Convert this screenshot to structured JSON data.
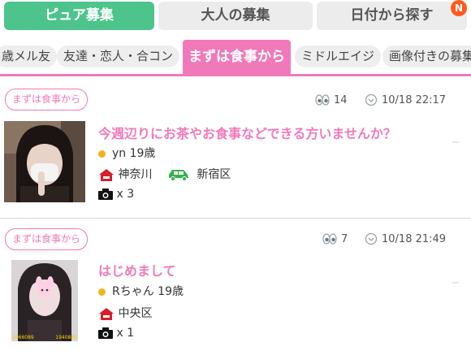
{
  "tabs": [
    {
      "label": "ピュア募集",
      "active": true
    },
    {
      "label": "大人の募集",
      "active": false
    },
    {
      "label": "日付から探す",
      "active": false
    }
  ],
  "notification_badge": "N",
  "categories": [
    {
      "label": "歳メル友",
      "active": false
    },
    {
      "label": "友達・恋人・合コン",
      "active": false
    },
    {
      "label": "まずは食事から",
      "active": true
    },
    {
      "label": "ミドルエイジ",
      "active": false
    },
    {
      "label": "画像付きの募集",
      "active": false
    }
  ],
  "posts": [
    {
      "tag": "まずは食事から",
      "views": "14",
      "datetime": "10/18 22:17",
      "title": "今週辺りにお茶やお食事などできる方いませんか？",
      "user": "yn 19歳",
      "home": "神奈川",
      "destination": "新宿区",
      "photos": "x 3"
    },
    {
      "tag": "まずは食事から",
      "views": "7",
      "datetime": "10/18 21:49",
      "title": "はじめまして",
      "user": "Rちゃん 19歳",
      "home": "中央区",
      "photos": "x 1",
      "thumb_caption_left": "2066089",
      "thumb_caption_right": "1940849"
    }
  ],
  "colors": {
    "accent_pink": "#f07ab9",
    "tab_green": "#4cc48b",
    "badge_orange": "#ff5a1f",
    "house_red": "#d81e2a",
    "car_green": "#35b04a",
    "status_yellow": "#f2b51d"
  },
  "icons": [
    "eye-icon",
    "clock-icon",
    "house-icon",
    "car-icon",
    "camera-icon"
  ]
}
